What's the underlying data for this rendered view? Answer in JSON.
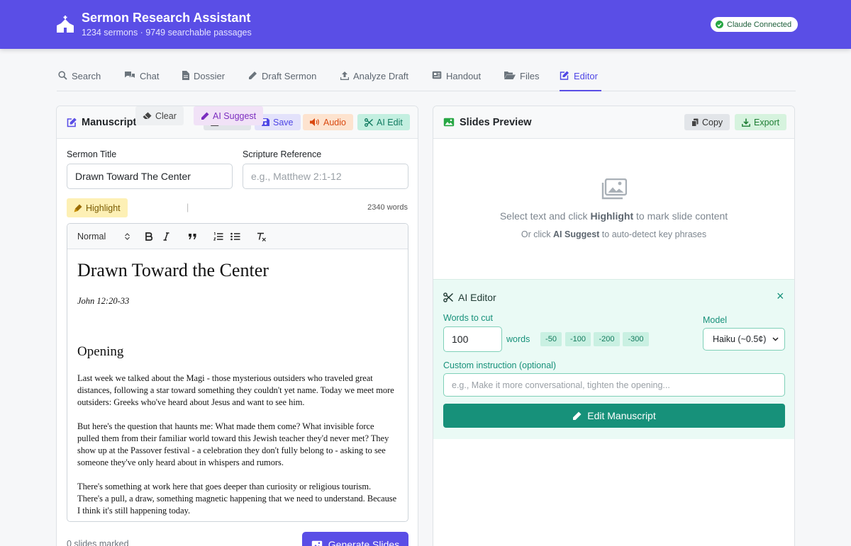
{
  "header": {
    "title": "Sermon Research Assistant",
    "subtitle": "1234 sermons · 9749 searchable passages",
    "status": "Claude Connected",
    "logo_icon": "church-icon"
  },
  "tabs": [
    {
      "label": "Search",
      "icon": "search-icon"
    },
    {
      "label": "Chat",
      "icon": "comments-icon"
    },
    {
      "label": "Dossier",
      "icon": "file-icon"
    },
    {
      "label": "Draft Sermon",
      "icon": "pencil-icon"
    },
    {
      "label": "Analyze Draft",
      "icon": "upload-icon"
    },
    {
      "label": "Handout",
      "icon": "newspaper-icon"
    },
    {
      "label": "Files",
      "icon": "folder-open-icon"
    },
    {
      "label": "Editor",
      "icon": "edit-icon",
      "active": true
    }
  ],
  "manuscript": {
    "title": "Manuscript Editor",
    "buttons": {
      "load": "Load",
      "save": "Save",
      "audio": "Audio",
      "ai_edit": "AI Edit"
    },
    "sermon_title_label": "Sermon Title",
    "sermon_title_value": "Drawn Toward The Center",
    "scripture_label": "Scripture Reference",
    "scripture_placeholder": "e.g., Matthew 2:1-12",
    "tools": {
      "highlight": "Highlight",
      "clear": "Clear",
      "separator": "|",
      "ai_suggest": "AI Suggest"
    },
    "word_count": "2340 words",
    "format_select": "Normal",
    "document": {
      "heading": "Drawn Toward the Center",
      "reference": "John 12:20-33",
      "section": "Opening",
      "paragraphs": [
        "Last week we talked about the Magi - those mysterious outsiders who traveled great distances, following a star toward something they couldn't yet name. Today we meet more outsiders: Greeks who've heard about Jesus and want to see him.",
        "But here's the question that haunts me: What made them come? What invisible force pulled them from their familiar world toward this Jewish teacher they'd never met? They show up at the Passover festival - a celebration they don't fully belong to - asking to see someone they've only heard about in whispers and rumors.",
        "There's something at work here that goes deeper than curiosity or religious tourism. There's a pull, a draw, something magnetic happening that we need to understand. Because I think it's still happening today."
      ]
    },
    "slides_marked": "0 slides marked",
    "generate_label": "Generate Slides"
  },
  "slides": {
    "title": "Slides Preview",
    "buttons": {
      "copy": "Copy",
      "export": "Export"
    },
    "empty_line1": {
      "pre": "Select text and click ",
      "bold": "Highlight",
      "post": " to mark slide content"
    },
    "empty_line2": {
      "pre": "Or click ",
      "bold": "AI Suggest",
      "post": " to auto-detect key phrases"
    }
  },
  "ai_editor": {
    "title": "AI Editor",
    "close": "×",
    "words_label": "Words to cut",
    "words_value": "100",
    "words_unit": "words",
    "chips": [
      "-50",
      "-100",
      "-200",
      "-300"
    ],
    "model_label": "Model",
    "model_value": "Haiku (~0.5¢)",
    "custom_label": "Custom instruction (optional)",
    "custom_placeholder": "e.g., Make it more conversational, tighten the opening...",
    "submit": "Edit Manuscript"
  },
  "colors": {
    "brand": "#5a4ee6",
    "teal": "#17917a",
    "success": "#28a745"
  }
}
